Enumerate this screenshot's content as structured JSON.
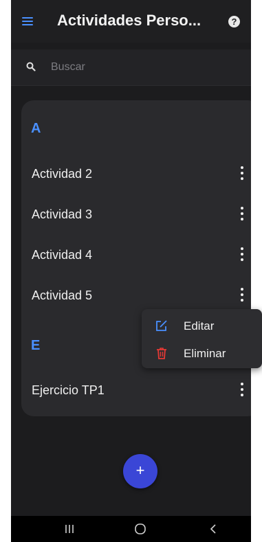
{
  "appbar": {
    "title": "Actividades Perso...",
    "help_label": "?"
  },
  "search": {
    "placeholder": "Buscar"
  },
  "sections": [
    {
      "header": "A",
      "items": [
        "Actividad 2",
        "Actividad 3",
        "Actividad 4",
        "Actividad 5"
      ]
    },
    {
      "header": "E",
      "items": [
        "Ejercicio TP1"
      ]
    }
  ],
  "context_menu": {
    "edit_label": "Editar",
    "delete_label": "Eliminar"
  },
  "fab": {
    "label": "+"
  },
  "colors": {
    "accent": "#4a90ff",
    "fab": "#3a46d6",
    "delete": "#e53935",
    "background": "#1c1c1e",
    "card": "#2a2a2d"
  },
  "icons": {
    "menu": "menu-icon",
    "help": "help-icon",
    "search": "search-icon",
    "more": "more-vert-icon",
    "edit": "edit-icon",
    "delete": "trash-icon",
    "nav_recents": "recents-icon",
    "nav_home": "home-icon",
    "nav_back": "back-icon"
  }
}
